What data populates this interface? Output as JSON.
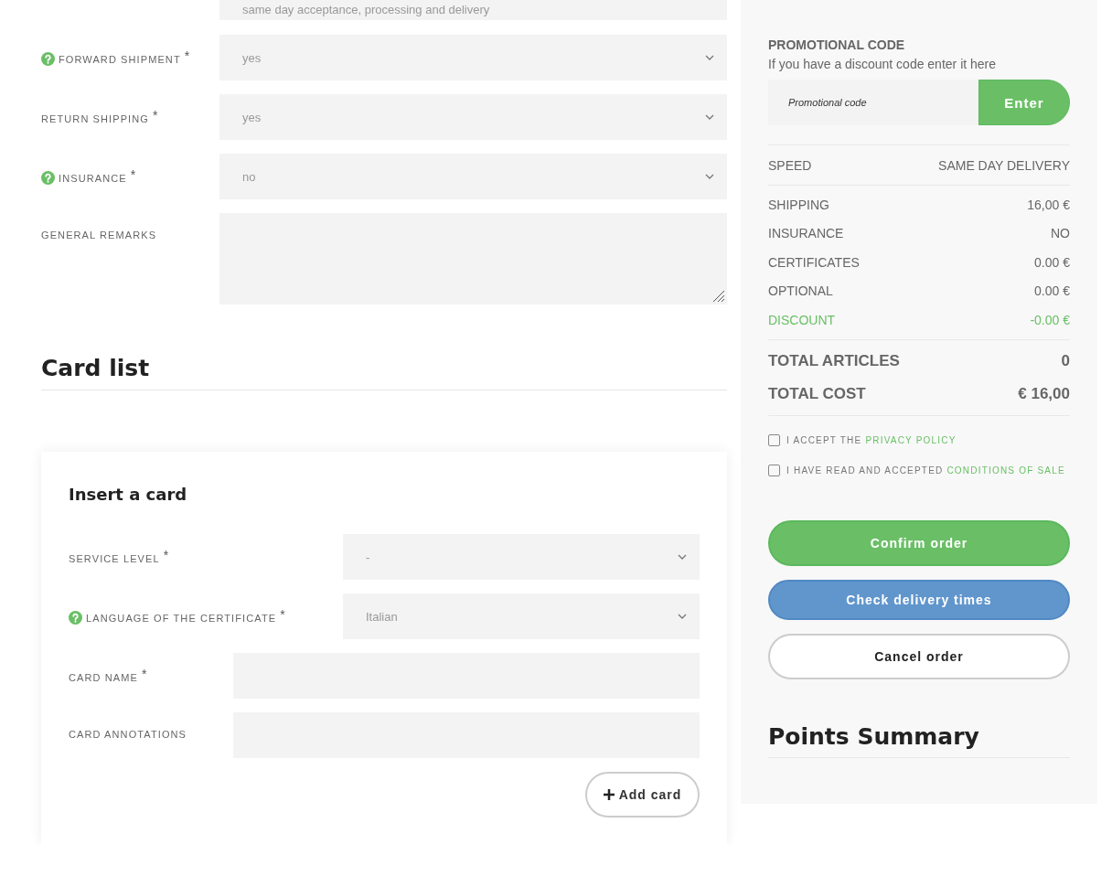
{
  "speed_select": {
    "value": "same day acceptance, processing and delivery"
  },
  "shipment_fields": [
    {
      "label": "FORWARD SHIPMENT",
      "help": true,
      "required_mark": "*",
      "kind": "select",
      "value": "yes"
    },
    {
      "label": "RETURN SHIPPING",
      "help": false,
      "required_mark": "*",
      "kind": "select",
      "value": "yes"
    },
    {
      "label": "INSURANCE",
      "help": true,
      "required_mark": "*",
      "kind": "select",
      "value": "no"
    },
    {
      "label": "GENERAL REMARKS",
      "help": false,
      "kind": "textarea"
    }
  ],
  "card_list": {
    "title": "Card list"
  },
  "insert_card": {
    "title": "Insert a card",
    "fields": [
      {
        "label": "SERVICE LEVEL",
        "help": false,
        "required_mark": "*",
        "kind": "select",
        "value": "-"
      },
      {
        "label": "LANGUAGE OF THE CERTIFICATE",
        "help": true,
        "required_mark": "*",
        "kind": "select",
        "value": "Italian"
      },
      {
        "label": "CARD NAME",
        "help": false,
        "required_mark": "*",
        "kind": "text"
      },
      {
        "label": "CARD ANNOTATIONS",
        "help": false,
        "kind": "text"
      }
    ],
    "add_button": "Add card"
  },
  "promo": {
    "title": "PROMOTIONAL CODE",
    "subtitle": "If you have a discount code enter it here",
    "placeholder": "Promotional code",
    "button": "Enter"
  },
  "speed": {
    "label": "SPEED",
    "value": "SAME DAY DELIVERY"
  },
  "costs": [
    {
      "label": "SHIPPING",
      "value": "16,00 €",
      "kind": "normal"
    },
    {
      "label": "INSURANCE",
      "value": "NO",
      "kind": "normal"
    },
    {
      "label": "CERTIFICATES",
      "value": "0.00 €",
      "kind": "normal"
    },
    {
      "label": "OPTIONAL",
      "value": "0.00 €",
      "kind": "normal"
    },
    {
      "label": "DISCOUNT",
      "value": "-0.00 €",
      "kind": "discount"
    }
  ],
  "totals": [
    {
      "label": "TOTAL ARTICLES",
      "value": "0"
    },
    {
      "label": "TOTAL COST",
      "value": "€ 16,00"
    }
  ],
  "agreements": [
    {
      "text": "I ACCEPT THE",
      "link": "PRIVACY POLICY",
      "checked": false
    },
    {
      "text": "I HAVE READ AND ACCEPTED",
      "link": "CONDITIONS OF SALE",
      "checked": false
    }
  ],
  "actions": [
    {
      "label": "Confirm order",
      "kind": "confirm"
    },
    {
      "label": "Check delivery times",
      "kind": "info"
    },
    {
      "label": "Cancel order",
      "kind": "cancel"
    }
  ],
  "points": {
    "title": "Points Summary"
  }
}
